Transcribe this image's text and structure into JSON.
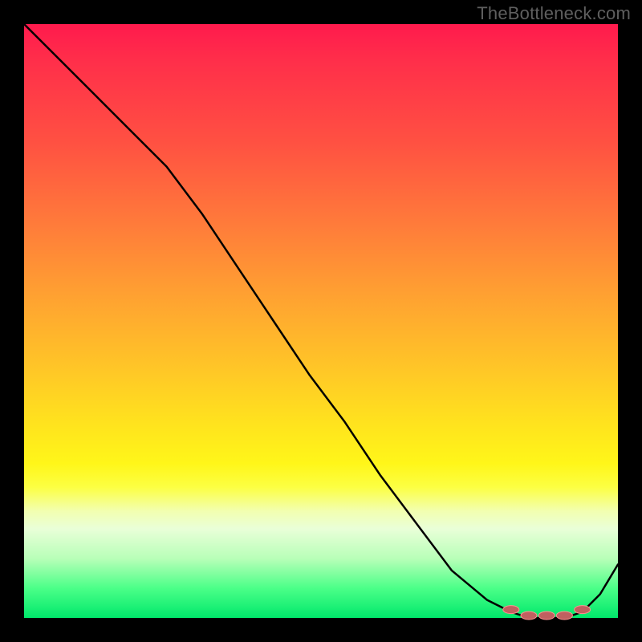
{
  "watermark": "TheBottleneck.com",
  "colors": {
    "page_bg": "#000000",
    "curve": "#000000",
    "marker_fill": "#c06060",
    "marker_stroke": "#ff9090"
  },
  "chart_data": {
    "type": "line",
    "title": "",
    "xlabel": "",
    "ylabel": "",
    "xlim": [
      0,
      100
    ],
    "ylim": [
      0,
      100
    ],
    "grid": false,
    "series": [
      {
        "name": "bottleneck-curve",
        "x": [
          0,
          6,
          12,
          18,
          24,
          30,
          36,
          42,
          48,
          54,
          60,
          66,
          72,
          78,
          82,
          85,
          88,
          91,
          94,
          97,
          100
        ],
        "values": [
          100,
          94,
          88,
          82,
          76,
          68,
          59,
          50,
          41,
          33,
          24,
          16,
          8,
          3,
          1,
          0,
          0,
          0,
          1,
          4,
          9
        ]
      }
    ],
    "markers": {
      "name": "optimal-band",
      "x": [
        82,
        85,
        88,
        91,
        94
      ],
      "values": [
        1,
        0,
        0,
        0,
        1
      ]
    },
    "gradient_stops": [
      {
        "pct": 0,
        "color": "#ff1a4d"
      },
      {
        "pct": 20,
        "color": "#ff5142"
      },
      {
        "pct": 46,
        "color": "#ffa231"
      },
      {
        "pct": 68,
        "color": "#ffe51d"
      },
      {
        "pct": 82,
        "color": "#f2ffb0"
      },
      {
        "pct": 100,
        "color": "#00e86b"
      }
    ]
  }
}
